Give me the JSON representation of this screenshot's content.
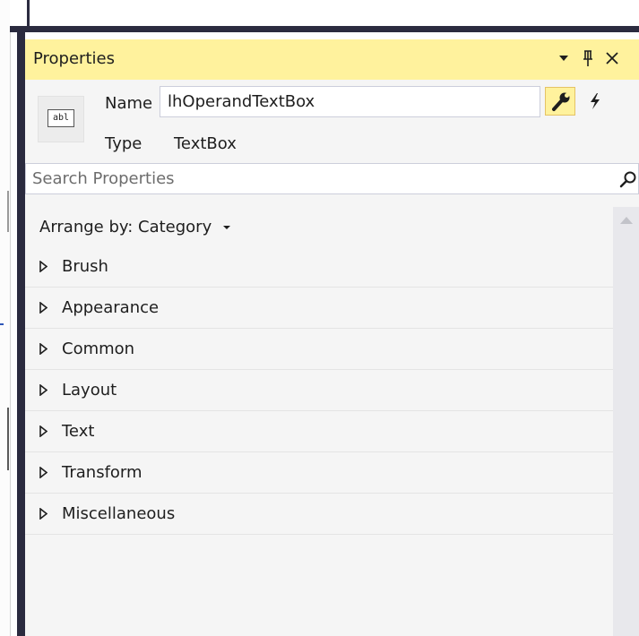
{
  "panel": {
    "title": "Properties",
    "name_label": "Name",
    "name_value": "lhOperandTextBox",
    "type_label": "Type",
    "type_value": "TextBox",
    "type_icon_text": "abl",
    "search_placeholder": "Search Properties",
    "arrange_label": "Arrange by: Category",
    "categories": [
      {
        "label": "Brush"
      },
      {
        "label": "Appearance"
      },
      {
        "label": "Common"
      },
      {
        "label": "Layout"
      },
      {
        "label": "Text"
      },
      {
        "label": "Transform"
      },
      {
        "label": "Miscellaneous"
      }
    ]
  },
  "icons": {
    "dropdown": "chevron-down-icon",
    "pin": "pin-icon",
    "close": "close-icon",
    "properties": "wrench-icon",
    "events": "lightning-icon",
    "search": "search-icon",
    "expand": "expand-triangle-icon",
    "arrange_dropdown": "caret-down-icon"
  },
  "colors": {
    "title_bar": "#fff29d",
    "frame_dark": "#2b2b3f",
    "panel_bg": "#f5f5f5",
    "border": "#cccedb"
  }
}
